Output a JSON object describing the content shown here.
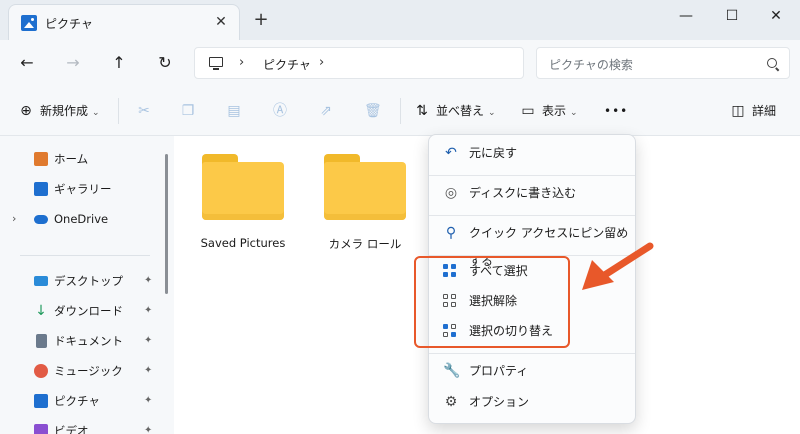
{
  "window": {
    "tab_title": "ピクチャ",
    "close_tab": "✕",
    "new_tab": "+",
    "minimize": "—",
    "maximize": "☐",
    "close": "✕"
  },
  "navigation": {
    "back": "←",
    "forward": "→",
    "up": "↑",
    "refresh": "↻",
    "breadcrumb_sep": "›",
    "breadcrumb": "ピクチャ",
    "search_placeholder": "ピクチャの検索"
  },
  "toolbar": {
    "new_label": "新規作成",
    "sort_label": "並べ替え",
    "view_label": "表示",
    "more": "•••",
    "details_label": "詳細"
  },
  "sidebar": {
    "items": [
      {
        "label": "ホーム",
        "icon": "home-icon",
        "color": "#e07a2e"
      },
      {
        "label": "ギャラリー",
        "icon": "gallery-icon",
        "color": "#1e6fcf"
      },
      {
        "label": "OneDrive",
        "icon": "onedrive-icon",
        "color": "#1e6fcf"
      },
      {
        "label": "デスクトップ",
        "icon": "desktop-icon",
        "color": "#2a8bd8"
      },
      {
        "label": "ダウンロード",
        "icon": "download-icon",
        "color": "#1f9a5c"
      },
      {
        "label": "ドキュメント",
        "icon": "document-icon",
        "color": "#6b7a8c"
      },
      {
        "label": "ミュージック",
        "icon": "music-icon",
        "color": "#e25b45"
      },
      {
        "label": "ピクチャ",
        "icon": "pictures-icon",
        "color": "#1e6fcf"
      },
      {
        "label": "ビデオ",
        "icon": "video-icon",
        "color": "#8a4fd1"
      }
    ],
    "pin": "📌",
    "expander": "›"
  },
  "folders": [
    {
      "name": "Saved Pictures"
    },
    {
      "name": "カメラ ロール"
    }
  ],
  "menu": {
    "items": [
      {
        "label": "元に戻す",
        "icon": "undo-icon"
      },
      {
        "label": "ディスクに書き込む",
        "icon": "burn-disc-icon"
      },
      {
        "label": "クイック アクセスにピン留めする",
        "icon": "pin-icon"
      },
      {
        "label": "すべて選択",
        "icon": "select-all-icon"
      },
      {
        "label": "選択解除",
        "icon": "select-none-icon"
      },
      {
        "label": "選択の切り替え",
        "icon": "invert-selection-icon"
      },
      {
        "label": "プロパティ",
        "icon": "properties-icon"
      },
      {
        "label": "オプション",
        "icon": "options-icon"
      }
    ]
  },
  "annotation": {
    "color": "#e8582a"
  }
}
